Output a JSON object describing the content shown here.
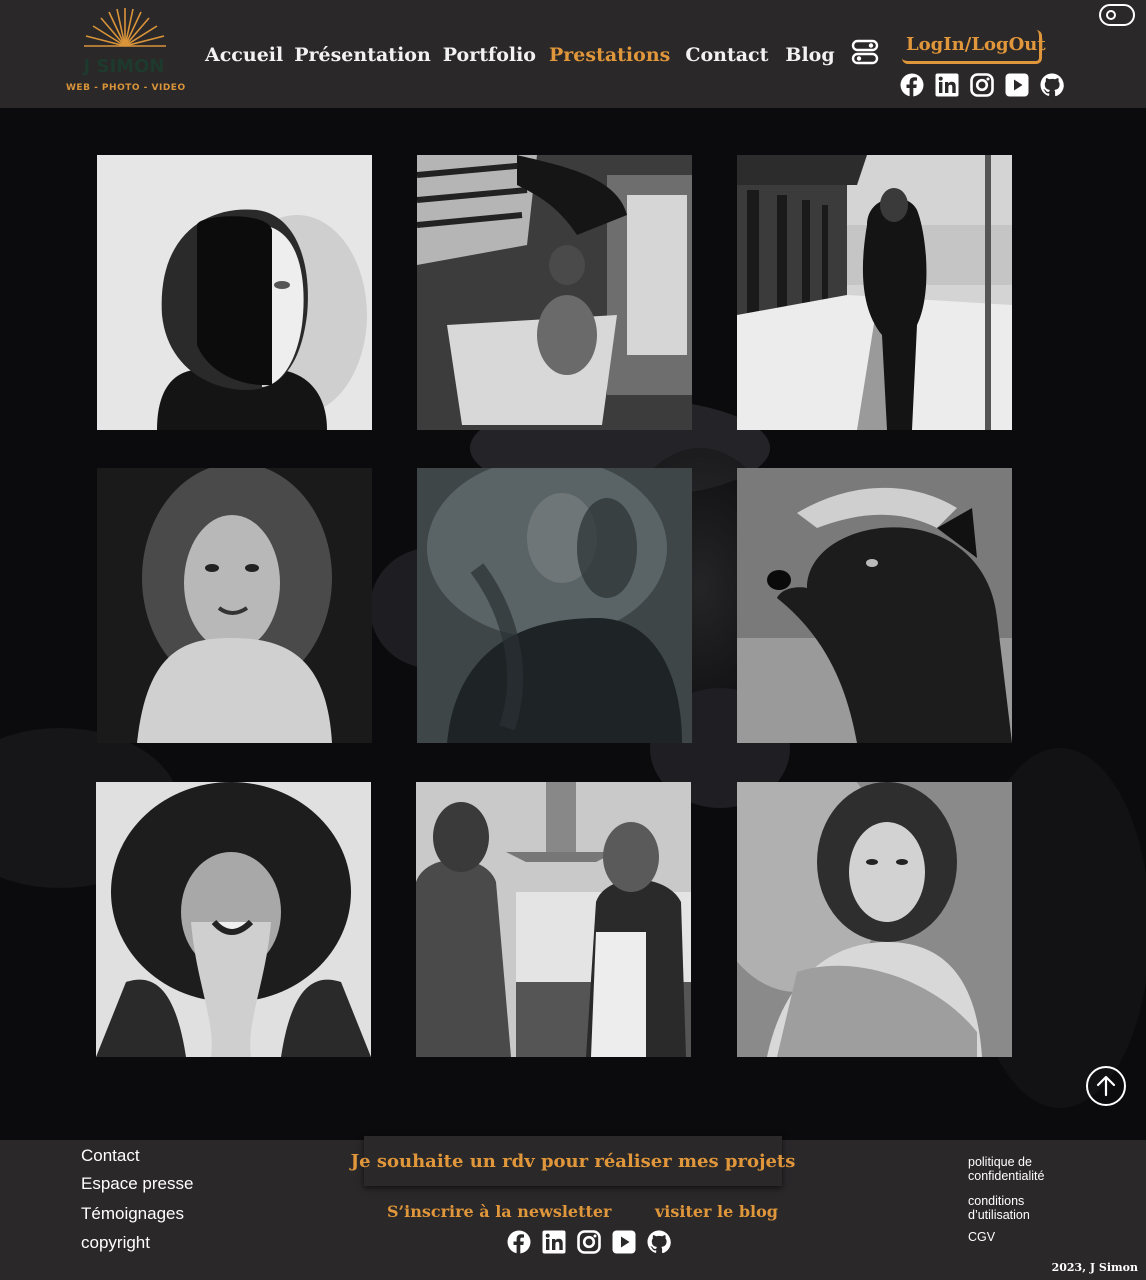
{
  "logo": {
    "name": "J SIMON",
    "tagline": "WEB - PHOTO - VIDEO",
    "accent": "#e0963a"
  },
  "nav": {
    "items": [
      {
        "label": "Accueil"
      },
      {
        "label": "Présentation"
      },
      {
        "label": "Portfolio"
      },
      {
        "label": "Prestations"
      },
      {
        "label": "Contact"
      },
      {
        "label": "Blog"
      }
    ],
    "active": "Prestations"
  },
  "header": {
    "login_label": "LogIn/LogOut"
  },
  "socials": [
    "facebook-icon",
    "linkedin-icon",
    "instagram-icon",
    "youtube-icon",
    "github-icon"
  ],
  "gallery": [
    "half-painted-face-portrait",
    "washing-child-in-tub",
    "woman-on-street-sidewalk",
    "curly-hair-woman-portrait",
    "misty-hair-portrait",
    "dog-being-petted",
    "laughing-woman-fur-hood",
    "couple-in-kitchen",
    "curly-hair-woman-posing"
  ],
  "footer": {
    "links": [
      "Contact",
      "Espace presse",
      "Témoignages",
      "copyright"
    ],
    "cta": "Je souhaite un rdv pour réaliser mes projets",
    "newsletter": "S’inscrire à la newsletter",
    "visit_blog": "visiter le blog",
    "legal": [
      "politique de confidentialité",
      "conditions d’utilisation",
      "CGV"
    ],
    "copyright": "2023, J Simon"
  },
  "colors": {
    "header_bg": "#2a2829",
    "accent": "#e0963a",
    "page_bg": "#0a0a0c"
  }
}
